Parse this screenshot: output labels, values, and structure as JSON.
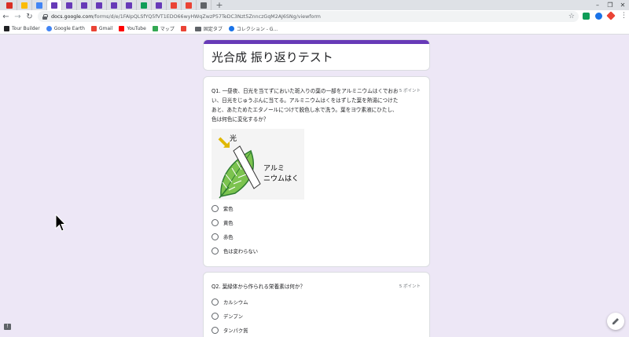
{
  "browser": {
    "url_host": "docs.google.com",
    "url_path": "/forms/d/e/1FAIpQLSfYQ5fVT1EDO66wyHWqZwzP57TeDC3Nzt5ZnnczGqM2AJ6SNg/viewform",
    "new_tab_label": "+",
    "tab_favicon_colors": [
      "#d93025",
      "#fbbc04",
      "#4285f4",
      "#673ab7",
      "#673ab7",
      "#673ab7",
      "#673ab7",
      "#673ab7",
      "#673ab7",
      "#0f9d58",
      "#673ab7",
      "#ea4335",
      "#ea4335",
      "#5f6368"
    ],
    "extension_colors": [
      "#0f9d58",
      "#1a73e8",
      "#ea4335"
    ]
  },
  "bookmarks": [
    {
      "label": "Tour Builder",
      "icon": "tour-builder-icon",
      "color": "#202124"
    },
    {
      "label": "Google Earth",
      "icon": "earth-icon",
      "color": "#4285f4"
    },
    {
      "label": "Gmail",
      "icon": "gmail-icon",
      "color": "#ea4335"
    },
    {
      "label": "YouTube",
      "icon": "youtube-icon",
      "color": "#ff0000"
    },
    {
      "label": "マップ",
      "icon": "maps-icon",
      "color": "#34a853"
    },
    {
      "label": "",
      "icon": "bookmark-red-icon",
      "color": "#ea4335"
    },
    {
      "label": "固定タブ",
      "icon": "folder-icon",
      "color": "#5f6368"
    },
    {
      "label": "コレクション - G...",
      "icon": "collections-icon",
      "color": "#1a73e8"
    }
  ],
  "form": {
    "title": "光合成 振り返りテスト",
    "accent": "#673ab7",
    "questions": [
      {
        "text": "Q1. 一昼夜、日光を当てずにおいた斑入りの葉の一部をアルミニウムはくでおおい、日光をじゅうぶんに当てる。アルミニウムはくをはずした葉を熱湯につけたあと、あたためたエタノールにつけて脱色し水で洗う。葉をヨウ素液にひたし、色は何色に変化するか？",
        "points": "5 ポイント",
        "figure_labels": {
          "light": "光",
          "foil": "アルミニウムはく"
        },
        "options": [
          "紫色",
          "黄色",
          "赤色",
          "色は変わらない"
        ]
      },
      {
        "text": "Q2. 葉緑体から作られる栄養素は何か？",
        "points": "5 ポイント",
        "options": [
          "カルシウム",
          "デンプン",
          "タンパク質"
        ]
      }
    ]
  }
}
